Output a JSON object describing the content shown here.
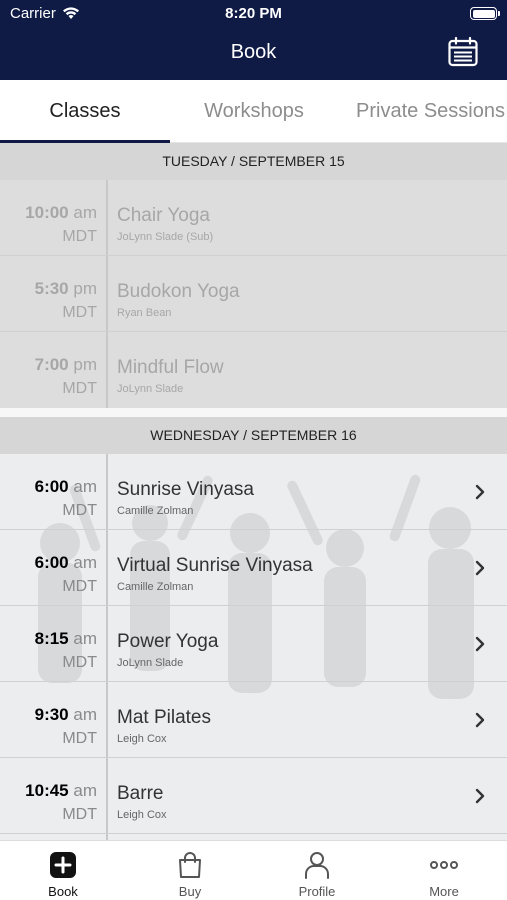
{
  "status_bar": {
    "carrier": "Carrier",
    "time": "8:20 PM"
  },
  "nav": {
    "title": "Book",
    "calendar_icon": "calendar-icon"
  },
  "tabs": [
    {
      "label": "Classes",
      "active": true
    },
    {
      "label": "Workshops",
      "active": false
    },
    {
      "label": "Private Sessions",
      "active": false
    }
  ],
  "days": [
    {
      "header": "TUESDAY / SEPTEMBER 15",
      "classes": [
        {
          "time": "10:00",
          "ampm": "am",
          "tz": "MDT",
          "name": "Chair Yoga",
          "instructor": "JoLynn Slade (Sub)",
          "past": true
        },
        {
          "time": "5:30",
          "ampm": "pm",
          "tz": "MDT",
          "name": "Budokon Yoga",
          "instructor": "Ryan Bean",
          "past": true
        },
        {
          "time": "7:00",
          "ampm": "pm",
          "tz": "MDT",
          "name": "Mindful Flow",
          "instructor": "JoLynn Slade",
          "past": true
        }
      ]
    },
    {
      "header": "WEDNESDAY / SEPTEMBER 16",
      "classes": [
        {
          "time": "6:00",
          "ampm": "am",
          "tz": "MDT",
          "name": "Sunrise Vinyasa",
          "instructor": "Camille Zolman",
          "past": false
        },
        {
          "time": "6:00",
          "ampm": "am",
          "tz": "MDT",
          "name": "Virtual Sunrise Vinyasa",
          "instructor": "Camille Zolman",
          "past": false
        },
        {
          "time": "8:15",
          "ampm": "am",
          "tz": "MDT",
          "name": "Power Yoga",
          "instructor": "JoLynn Slade",
          "past": false
        },
        {
          "time": "9:30",
          "ampm": "am",
          "tz": "MDT",
          "name": "Mat Pilates",
          "instructor": "Leigh Cox",
          "past": false
        },
        {
          "time": "10:45",
          "ampm": "am",
          "tz": "MDT",
          "name": "Barre",
          "instructor": "Leigh Cox",
          "past": false
        }
      ]
    }
  ],
  "tabbar": [
    {
      "label": "Book",
      "icon": "plus-square-icon",
      "active": true
    },
    {
      "label": "Buy",
      "icon": "shopping-bag-icon",
      "active": false
    },
    {
      "label": "Profile",
      "icon": "person-icon",
      "active": false
    },
    {
      "label": "More",
      "icon": "more-dots-icon",
      "active": false
    }
  ],
  "colors": {
    "header_bg": "#0f1b45",
    "day_header_bg": "#d6d6d6",
    "accent": "#0f1b45"
  }
}
